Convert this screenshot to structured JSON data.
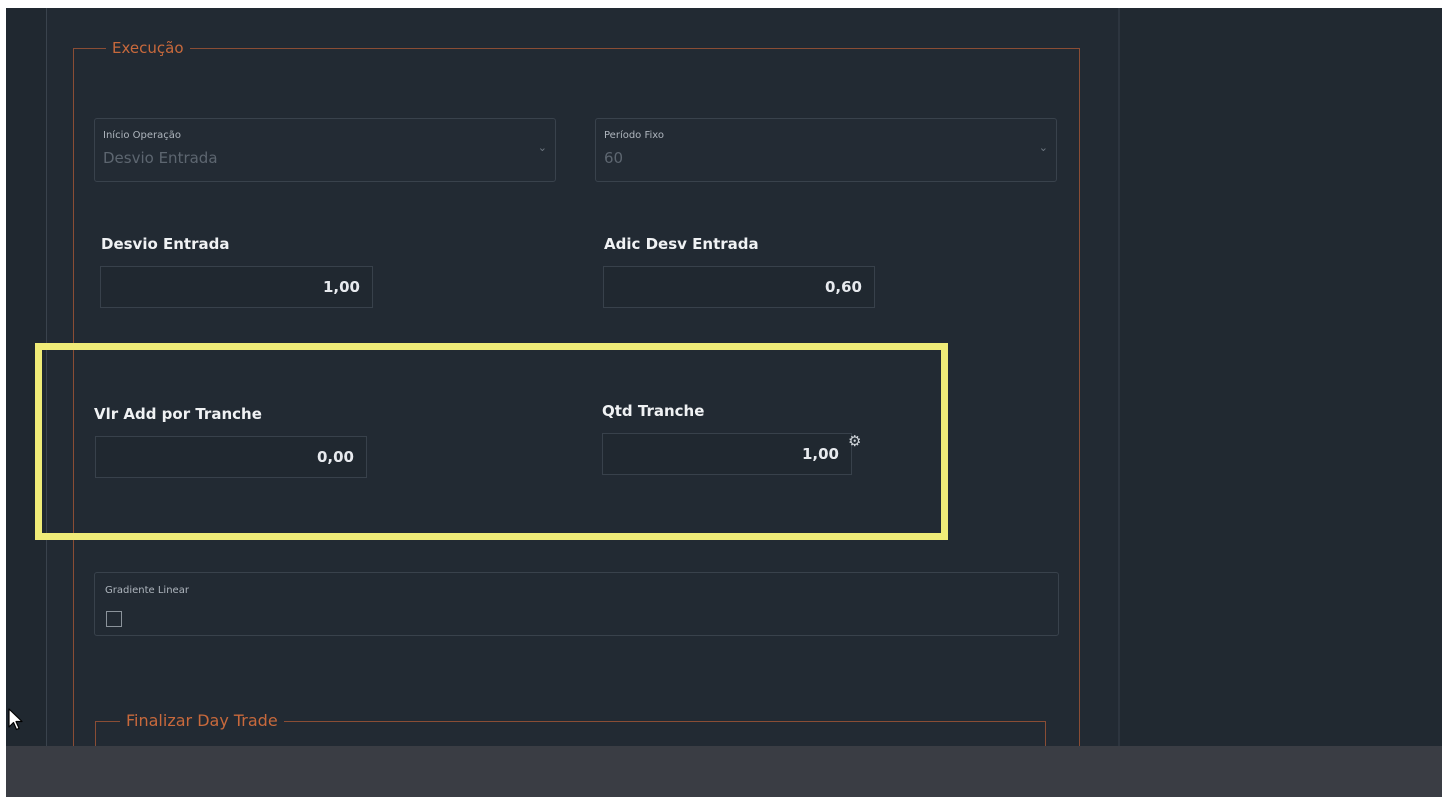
{
  "execucao": {
    "legend": "Execução",
    "inicio_operacao": {
      "label": "Início Operação",
      "value": "Desvio Entrada"
    },
    "periodo_fixo": {
      "label": "Período Fixo",
      "value": "60"
    },
    "desvio_entrada": {
      "label": "Desvio Entrada",
      "value": "1,00"
    },
    "adic_desv_entrada": {
      "label": "Adic Desv Entrada",
      "value": "0,60"
    },
    "vlr_add_por_tranche": {
      "label": "Vlr Add por Tranche",
      "value": "0,00"
    },
    "qtd_tranche": {
      "label": "Qtd Tranche",
      "value": "1,00"
    },
    "gradiente_linear": {
      "label": "Gradiente Linear",
      "checked": false
    }
  },
  "finalizar_day_trade": {
    "legend": "Finalizar Day Trade"
  },
  "icons": {
    "select_chevron": "chevron-down-icon",
    "settings": "gear-icon",
    "pointer": "mouse-cursor-icon"
  },
  "colors": {
    "background": "#222a33",
    "legend_text": "#c8693c",
    "fieldset_border": "#8a4d35",
    "highlight": "#f0ec78"
  }
}
